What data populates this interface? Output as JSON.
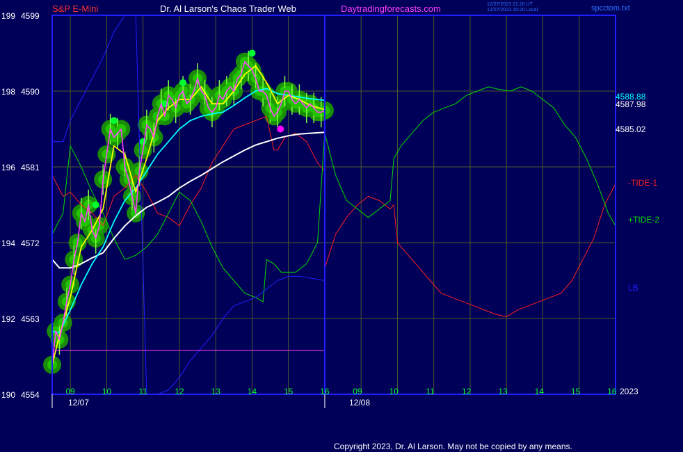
{
  "header": {
    "symbol": "S&P E-Mini",
    "title": "Dr. Al Larson's Chaos Trader Web",
    "site": "Daytradingforecasts.com",
    "timestamp_ut": "12/07/2023 21:20 UT",
    "timestamp_local": "12/07/2023 16:20 Local",
    "filename": "spcctom.txt"
  },
  "footer": {
    "copyright": "Copyright 2023, Dr. Al Larson. May not be copied by any means."
  },
  "chart_data": {
    "type": "line",
    "y_left_labels": [
      {
        "angle": "199",
        "price": "4599",
        "value": 4599
      },
      {
        "angle": "198",
        "price": "4590",
        "value": 4590
      },
      {
        "angle": "196",
        "price": "4581",
        "value": 4581
      },
      {
        "angle": "194",
        "price": "4572",
        "value": 4572
      },
      {
        "angle": "192",
        "price": "4563",
        "value": 4563
      },
      {
        "angle": "190",
        "price": "4554",
        "value": 4554
      }
    ],
    "ylim": [
      4554,
      4599
    ],
    "x_hours_day1": [
      "09",
      "10",
      "11",
      "12",
      "13",
      "14",
      "15",
      "16"
    ],
    "x_hours_day2": [
      "09",
      "10",
      "11",
      "12",
      "13",
      "14",
      "15",
      "16"
    ],
    "x_dates": [
      "12/07",
      "12/08"
    ],
    "year": "2023",
    "right_values": [
      {
        "label": "4588.88",
        "value": 4588.88,
        "color": "#00ffff"
      },
      {
        "label": "4587.98",
        "value": 4587.98,
        "color": "#ffffff"
      },
      {
        "label": "4585.02",
        "value": 4585.02,
        "color": "#ffffff"
      }
    ],
    "legend": [
      {
        "label": "-TIDE-1",
        "color": "#ff2020"
      },
      {
        "label": "+TIDE-2",
        "color": "#00e000"
      },
      {
        "label": "LB",
        "color": "#2020ff"
      }
    ],
    "x_range": [
      8.5,
      24.0
    ],
    "divider_x": 16,
    "horizontal_level": {
      "value": 4559.2,
      "x_from": 8.5,
      "x_to": 16
    },
    "magenta_dot": {
      "x": 14.78,
      "y": 4585.5
    },
    "series": [
      {
        "name": "price",
        "color": "#ff40ff",
        "width": 1.6,
        "x": [
          8.5,
          8.6,
          8.7,
          8.8,
          8.9,
          9.0,
          9.1,
          9.2,
          9.3,
          9.4,
          9.5,
          9.6,
          9.7,
          9.8,
          9.9,
          10.0,
          10.1,
          10.2,
          10.3,
          10.4,
          10.5,
          10.6,
          10.7,
          10.8,
          10.9,
          11.0,
          11.1,
          11.2,
          11.3,
          11.4,
          11.5,
          11.6,
          11.7,
          11.8,
          11.9,
          12.0,
          12.1,
          12.2,
          12.3,
          12.4,
          12.5,
          12.6,
          12.7,
          12.8,
          12.9,
          13.0,
          13.1,
          13.2,
          13.3,
          13.4,
          13.5,
          13.6,
          13.7,
          13.8,
          13.9,
          14.0,
          14.1,
          14.2,
          14.3,
          14.4,
          14.5,
          14.6,
          14.7,
          14.8,
          14.9,
          15.0,
          15.1,
          15.2,
          15.3,
          15.4,
          15.5,
          15.6,
          15.7,
          15.8,
          15.9,
          16.0
        ],
        "y": [
          4557.5,
          4561.5,
          4560.5,
          4562.5,
          4565.0,
          4567.0,
          4570.0,
          4572.0,
          4575.5,
          4574.5,
          4576.5,
          4573.5,
          4572.5,
          4574.0,
          4579.5,
          4582.5,
          4585.5,
          4584.5,
          4585.0,
          4585.5,
          4581.0,
          4579.5,
          4577.5,
          4575.5,
          4580.5,
          4583.0,
          4586.0,
          4585.5,
          4584.5,
          4587.0,
          4588.5,
          4587.0,
          4589.5,
          4589.0,
          4588.0,
          4589.5,
          4590.0,
          4588.5,
          4589.0,
          4590.0,
          4591.5,
          4590.0,
          4589.5,
          4588.0,
          4587.5,
          4588.0,
          4589.5,
          4589.0,
          4590.0,
          4590.5,
          4590.0,
          4591.5,
          4592.0,
          4593.5,
          4593.0,
          4592.5,
          4591.5,
          4590.0,
          4590.0,
          4589.5,
          4588.0,
          4587.0,
          4587.5,
          4588.5,
          4590.0,
          4590.0,
          4589.0,
          4588.5,
          4589.0,
          4588.5,
          4588.0,
          4588.5,
          4588.0,
          4587.5,
          4587.5,
          4587.7
        ]
      },
      {
        "name": "fast",
        "color": "#ffff00",
        "width": 1.8,
        "x": [
          8.5,
          8.7,
          9.0,
          9.3,
          9.6,
          9.9,
          10.2,
          10.5,
          10.8,
          11.1,
          11.4,
          11.7,
          12.0,
          12.3,
          12.6,
          12.9,
          13.2,
          13.5,
          13.8,
          14.1,
          14.4,
          14.7,
          15.0,
          15.3,
          15.6,
          16.0
        ],
        "y": [
          4557.5,
          4561.0,
          4565.5,
          4571.5,
          4573.5,
          4576.0,
          4583.5,
          4582.5,
          4578.0,
          4582.0,
          4586.5,
          4588.0,
          4589.0,
          4589.0,
          4590.5,
          4588.5,
          4588.5,
          4590.0,
          4592.0,
          4593.0,
          4591.0,
          4588.5,
          4589.5,
          4589.0,
          4588.3,
          4587.8
        ]
      },
      {
        "name": "slow",
        "color": "#00ffff",
        "width": 1.8,
        "x": [
          8.5,
          8.7,
          9.0,
          9.3,
          9.6,
          9.9,
          10.2,
          10.5,
          10.8,
          11.1,
          11.4,
          11.7,
          12.0,
          12.3,
          12.6,
          12.9,
          13.2,
          13.5,
          13.8,
          14.1,
          14.4,
          14.7,
          15.0,
          15.3,
          15.6,
          16.0
        ],
        "y": [
          4561.5,
          4561.3,
          4564.0,
          4567.0,
          4569.5,
          4571.5,
          4574.5,
          4577.0,
          4578.5,
          4580.5,
          4582.5,
          4584.0,
          4585.5,
          4586.5,
          4587.0,
          4587.3,
          4587.5,
          4588.3,
          4589.2,
          4590.0,
          4590.3,
          4589.7,
          4589.5,
          4589.3,
          4589.1,
          4588.9
        ]
      },
      {
        "name": "avg",
        "color": "#ffffff",
        "width": 2.0,
        "x": [
          8.5,
          8.7,
          9.0,
          9.3,
          9.6,
          9.9,
          10.2,
          10.5,
          10.8,
          11.1,
          11.4,
          11.7,
          12.0,
          12.3,
          12.6,
          12.9,
          13.2,
          13.5,
          13.8,
          14.1,
          14.4,
          14.7,
          15.0,
          15.3,
          15.6,
          16.0
        ],
        "y": [
          4570.0,
          4569.0,
          4569.0,
          4569.5,
          4570.2,
          4570.8,
          4572.5,
          4574.0,
          4575.2,
          4576.2,
          4576.8,
          4577.5,
          4578.5,
          4579.3,
          4580.0,
          4580.8,
          4581.6,
          4582.3,
          4583.0,
          4583.6,
          4584.0,
          4584.4,
          4584.7,
          4584.9,
          4585.0,
          4585.1
        ]
      },
      {
        "name": "tide1",
        "color": "#ff2020",
        "width": 1.0,
        "x": [
          8.5,
          8.8,
          9.0,
          9.3,
          9.6,
          9.9,
          10.2,
          10.5,
          10.8,
          11.1,
          11.4,
          11.7,
          12.0,
          12.3,
          12.6,
          12.9,
          13.2,
          13.5,
          13.8,
          14.1,
          14.4,
          14.6,
          14.7,
          14.9,
          15.2,
          15.5,
          15.8,
          16.0,
          16.001,
          16.3,
          16.6,
          16.9,
          17.2,
          17.5,
          17.8,
          17.9,
          18.0,
          18.3,
          18.6,
          18.9,
          19.2,
          19.5,
          19.8,
          20.1,
          20.4,
          20.7,
          21.0,
          21.3,
          21.6,
          21.9,
          22.2,
          22.5,
          22.8,
          23.1,
          23.4,
          23.7,
          24.0
        ],
        "y": [
          4580.0,
          4577.5,
          4578.0,
          4576.5,
          4575.5,
          4574.0,
          4577.5,
          4578.5,
          4580.0,
          4578.0,
          4575.5,
          4575.0,
          4574.0,
          4576.5,
          4578.5,
          4581.5,
          4583.5,
          4585.5,
          4586.0,
          4586.5,
          4587.0,
          4583.0,
          4583.0,
          4584.5,
          4585.0,
          4584.0,
          4581.5,
          4580.5,
          4569.0,
          4573.0,
          4575.0,
          4576.5,
          4577.5,
          4577.0,
          4576.0,
          4576.5,
          4572.0,
          4570.5,
          4569.0,
          4567.5,
          4566.0,
          4565.5,
          4565.0,
          4564.5,
          4564.0,
          4563.5,
          4563.2,
          4564.0,
          4564.5,
          4565.0,
          4565.5,
          4566.0,
          4567.5,
          4570.0,
          4572.5,
          4576.5,
          4579.0
        ]
      },
      {
        "name": "tide2",
        "color": "#00e000",
        "width": 1.0,
        "x": [
          8.5,
          8.8,
          9.0,
          9.3,
          9.6,
          9.9,
          10.2,
          10.5,
          10.8,
          11.1,
          11.4,
          11.7,
          12.0,
          12.3,
          12.6,
          12.9,
          13.2,
          13.5,
          13.8,
          14.1,
          14.3,
          14.4,
          14.6,
          14.8,
          15.2,
          15.5,
          15.8,
          16.0,
          16.3,
          16.6,
          16.9,
          17.2,
          17.5,
          17.8,
          17.9,
          18.1,
          18.4,
          18.7,
          19.0,
          19.3,
          19.6,
          19.9,
          20.2,
          20.5,
          20.8,
          21.1,
          21.4,
          21.7,
          22.0,
          22.3,
          22.6,
          22.9,
          23.2,
          23.5,
          23.8,
          24.0
        ],
        "y": [
          4573.0,
          4575.5,
          4583.5,
          4581.0,
          4578.0,
          4575.5,
          4572.5,
          4570.0,
          4570.5,
          4571.5,
          4573.0,
          4575.5,
          4578.0,
          4577.0,
          4574.5,
          4571.5,
          4569.0,
          4567.5,
          4566.0,
          4565.5,
          4565.0,
          4570.0,
          4569.5,
          4568.5,
          4568.5,
          4569.5,
          4572.0,
          4585.0,
          4580.0,
          4577.0,
          4576.0,
          4575.0,
          4576.0,
          4577.0,
          4582.0,
          4583.5,
          4585.0,
          4586.5,
          4587.5,
          4588.0,
          4588.5,
          4589.5,
          4590.0,
          4590.5,
          4590.2,
          4590.0,
          4590.5,
          4590.0,
          4589.0,
          4588.0,
          4586.0,
          4584.5,
          4582.0,
          4579.0,
          4575.5,
          4574.0
        ]
      },
      {
        "name": "lb",
        "color": "#2020ff",
        "width": 1.0,
        "x": [
          8.5,
          8.8,
          9.0,
          9.3,
          9.6,
          9.9,
          10.2,
          10.5,
          10.8,
          11.1,
          11.4,
          11.7,
          12.0,
          12.3,
          12.6,
          12.9,
          13.2,
          13.5,
          13.8,
          14.1,
          14.4,
          14.7,
          15.0,
          15.3,
          15.6,
          16.0
        ],
        "y": [
          4584.0,
          4584.0,
          4586.5,
          4589.0,
          4591.5,
          4594.0,
          4597.0,
          4600.0,
          4601.0,
          4552.5,
          4553.5,
          4554.5,
          4556.0,
          4558.0,
          4559.5,
          4561.0,
          4563.0,
          4564.5,
          4565.0,
          4565.5,
          4566.5,
          4567.5,
          4568.0,
          4568.0,
          4567.8,
          4567.5
        ]
      }
    ]
  }
}
